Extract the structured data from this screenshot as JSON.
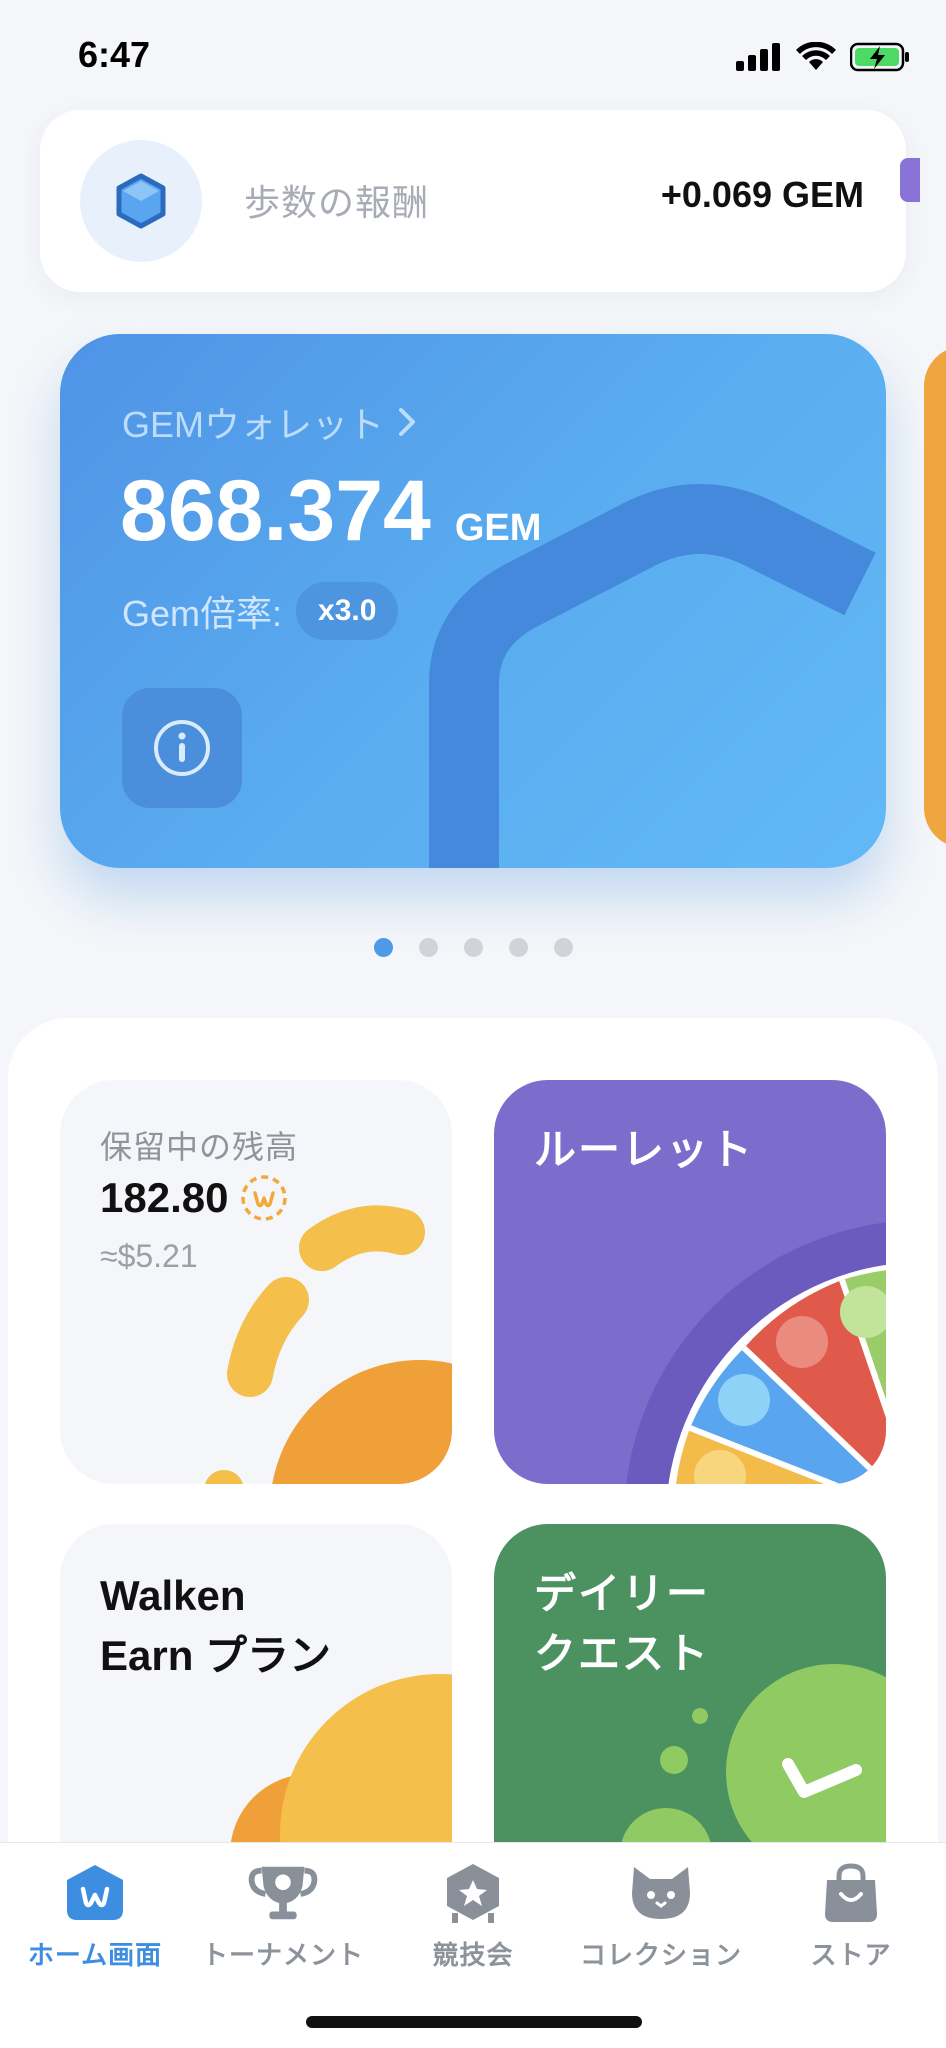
{
  "status_bar": {
    "time": "6:47"
  },
  "step_reward": {
    "label": "歩数の報酬",
    "value": "+0.069 GEM"
  },
  "wallet": {
    "title": "GEMウォレット",
    "amount": "868.374",
    "unit": "GEM",
    "multiplier_label": "Gem倍率:",
    "multiplier_value": "x3.0"
  },
  "pagination": {
    "total": 5,
    "active_index": 0
  },
  "tiles": {
    "balance": {
      "label": "保留中の残高",
      "amount": "182.80",
      "usd": "≈$5.21"
    },
    "roulette": {
      "title": "ルーレット"
    },
    "earn_plan": {
      "line1": "Walken",
      "line2": "Earn プラン"
    },
    "daily_quest": {
      "line1": "デイリー",
      "line2": "クエスト"
    }
  },
  "nav": {
    "items": [
      {
        "label": "ホーム画面",
        "icon": "home-w-icon",
        "active": true
      },
      {
        "label": "トーナメント",
        "icon": "trophy-icon",
        "active": false
      },
      {
        "label": "競技会",
        "icon": "star-hexagon-icon",
        "active": false
      },
      {
        "label": "コレクション",
        "icon": "cat-icon",
        "active": false
      },
      {
        "label": "ストア",
        "icon": "shopping-bag-icon",
        "active": false
      }
    ]
  },
  "colors": {
    "accent_blue": "#4f9ae8",
    "roulette_purple": "#7c6dcd",
    "quest_green": "#4c9160",
    "orange": "#f0a63e",
    "yellow": "#f3bc4a"
  }
}
